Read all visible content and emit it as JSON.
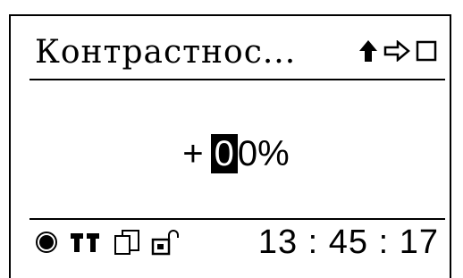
{
  "header": {
    "title": "Контрастнос...",
    "icons": [
      "arrow-up-icon",
      "arrow-right-outline-icon",
      "square-icon"
    ]
  },
  "value": {
    "sign": "+",
    "cursor_digit": "0",
    "rest": "0%"
  },
  "footer": {
    "icons": [
      "record-dot-icon",
      "signal-bars-icon",
      "copy-pages-icon",
      "unlocked-padlock-icon"
    ],
    "time": "13 : 45 : 17"
  }
}
